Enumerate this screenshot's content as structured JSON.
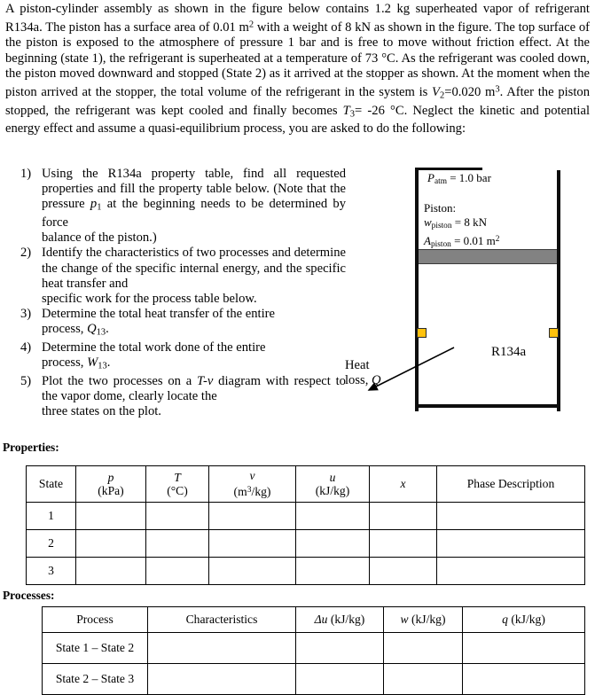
{
  "problem": {
    "paragraph_lines": [
      "A piston-cylinder assembly as shown in the figure below contains 1.2 kg superheated vapor of",
      "refrigerant R134a. The piston has a surface area of 0.01 m² with a weight of 8 kN as shown in",
      "the figure. The top surface of the piston is exposed to the atmosphere of pressure 1 bar and is free",
      "to move without friction effect. At the beginning (state 1), the refrigerant is superheated at a",
      "temperature of 73 °C. As the refrigerant was cooled down, the piston moved downward and",
      "stopped (State 2) as it arrived at the stopper as shown. At the moment when the piston arrived at",
      "the stopper, the total volume of the refrigerant in the system is V₂=0.020 m³. After the piston",
      "stopped, the refrigerant was kept cooled and finally becomes T₃= -26 °C. Neglect the kinetic and",
      "potential energy effect and assume a quasi-equilibrium process, you are asked to do the",
      "following:"
    ],
    "mass": "1.2 kg",
    "refrigerant": "R134a",
    "piston_area": "0.01 m²",
    "piston_weight": "8 kN",
    "atm_pressure": "1 bar",
    "T1": "73 °C",
    "V2": "0.020 m³",
    "T3": "-26 °C"
  },
  "tasks": [
    {
      "num": "1)",
      "text": "Using the R134a property table, find all requested properties and fill the property table below. (Note that the pressure p",
      "text_sub": "1",
      "text_tail": " at the beginning needs to be determined by force",
      "last_line": "balance of the piston.)"
    },
    {
      "num": "2)",
      "text": "Identify the characteristics of two processes and determine the change of the specific internal energy, and the specific heat transfer and",
      "last_line": "specific work for the process table below."
    },
    {
      "num": "3)",
      "text": "Determine the total heat transfer of the entire",
      "last_line": "process, Q₁₃."
    },
    {
      "num": "4)",
      "text": "Determine the total work done of the entire",
      "last_line": "process, W₁₃."
    },
    {
      "num": "5)",
      "text": "Plot the two processes on a T-v diagram with respect to the vapor dome, clearly locate the",
      "last_line": "three states on the plot."
    }
  ],
  "figure": {
    "atm_label_prefix": "P",
    "atm_label_sub": "atm",
    "atm_label_value": " = 1.0 bar",
    "piston_heading": "Piston:",
    "piston_weight_prefix": "w",
    "piston_weight_sub": "piston",
    "piston_weight_value": " = 8 kN",
    "piston_area_prefix": "A",
    "piston_area_sub": "piston",
    "piston_area_value": " = 0.01 m",
    "piston_area_sup": "2",
    "substance_label": "R134a",
    "heat_label_line1": "Heat",
    "heat_label_line2_prefix": "loss, ",
    "heat_label_line2_symbol": "Q",
    "stopper_color": "#ffc20e",
    "piston_color": "#828282",
    "wall_color": "#0d0d0d"
  },
  "properties_section": {
    "caption": "Properties:",
    "headers": [
      {
        "main": "State",
        "unit": ""
      },
      {
        "main": "p",
        "unit": "(kPa)"
      },
      {
        "main": "T",
        "unit": "(°C)"
      },
      {
        "main": "v",
        "unit": "(m³/kg)"
      },
      {
        "main": "u",
        "unit": "(kJ/kg)"
      },
      {
        "main": "x",
        "unit": ""
      },
      {
        "main": "Phase Description",
        "unit": ""
      }
    ],
    "rows": [
      {
        "state": "1",
        "p": "",
        "T": "",
        "v": "",
        "u": "",
        "x": "",
        "phase": ""
      },
      {
        "state": "2",
        "p": "",
        "T": "",
        "v": "",
        "u": "",
        "x": "",
        "phase": ""
      },
      {
        "state": "3",
        "p": "",
        "T": "",
        "v": "",
        "u": "",
        "x": "",
        "phase": ""
      }
    ]
  },
  "processes_section": {
    "caption": "Processes:",
    "headers": [
      "Process",
      "Characteristics",
      "Δu (kJ/kg)",
      "w (kJ/kg)",
      "q (kJ/kg)"
    ],
    "rows": [
      {
        "process": "State 1 – State 2",
        "characteristics": "",
        "du": "",
        "w": "",
        "q": ""
      },
      {
        "process": "State 2 – State 3",
        "characteristics": "",
        "du": "",
        "w": "",
        "q": ""
      }
    ]
  }
}
